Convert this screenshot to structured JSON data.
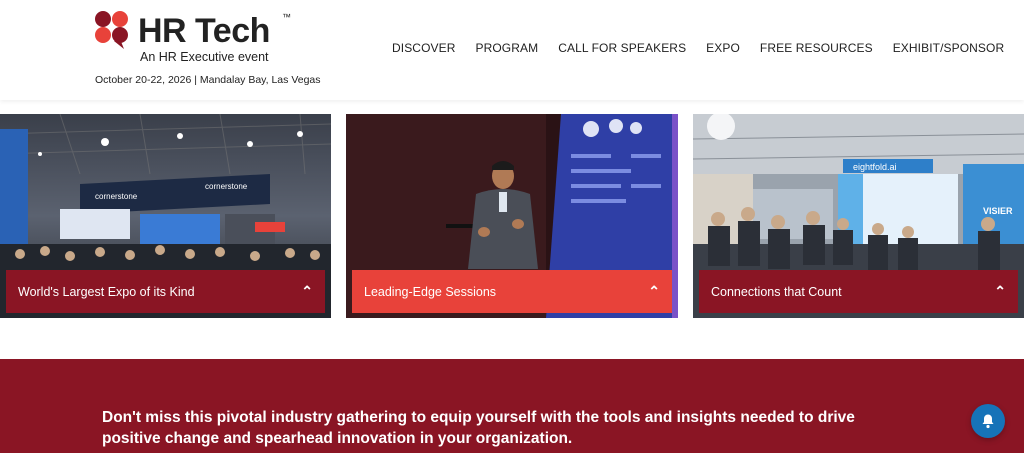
{
  "header": {
    "logo_title": "HR Tech",
    "logo_tm": "™",
    "logo_subtitle": "An HR Executive event",
    "event_date": "October 20-22, 2026 | Mandalay Bay, Las Vegas",
    "brand_colors": {
      "dark_red": "#8a1524",
      "red": "#e8423a"
    }
  },
  "nav": {
    "items": [
      {
        "label": "DISCOVER"
      },
      {
        "label": "PROGRAM"
      },
      {
        "label": "CALL FOR SPEAKERS"
      },
      {
        "label": "EXPO"
      },
      {
        "label": "FREE RESOURCES"
      },
      {
        "label": "EXHIBIT/SPONSOR"
      }
    ]
  },
  "cards": [
    {
      "label": "World's Largest Expo of its Kind",
      "icon": "chevron-up-icon"
    },
    {
      "label": "Leading-Edge Sessions",
      "icon": "chevron-up-icon"
    },
    {
      "label": "Connections that Count",
      "icon": "chevron-up-icon"
    }
  ],
  "photo_text": {
    "card1_sign1": "cornerstone",
    "card1_sign2": "cornerstone",
    "card3_sign1": "eightfold.ai",
    "card3_sign2": "VISIER"
  },
  "banner": {
    "text": "Don't miss this pivotal industry gathering to equip yourself with the tools and insights needed to drive positive change and spearhead innovation in your organization."
  },
  "notification": {
    "icon": "bell-icon"
  }
}
